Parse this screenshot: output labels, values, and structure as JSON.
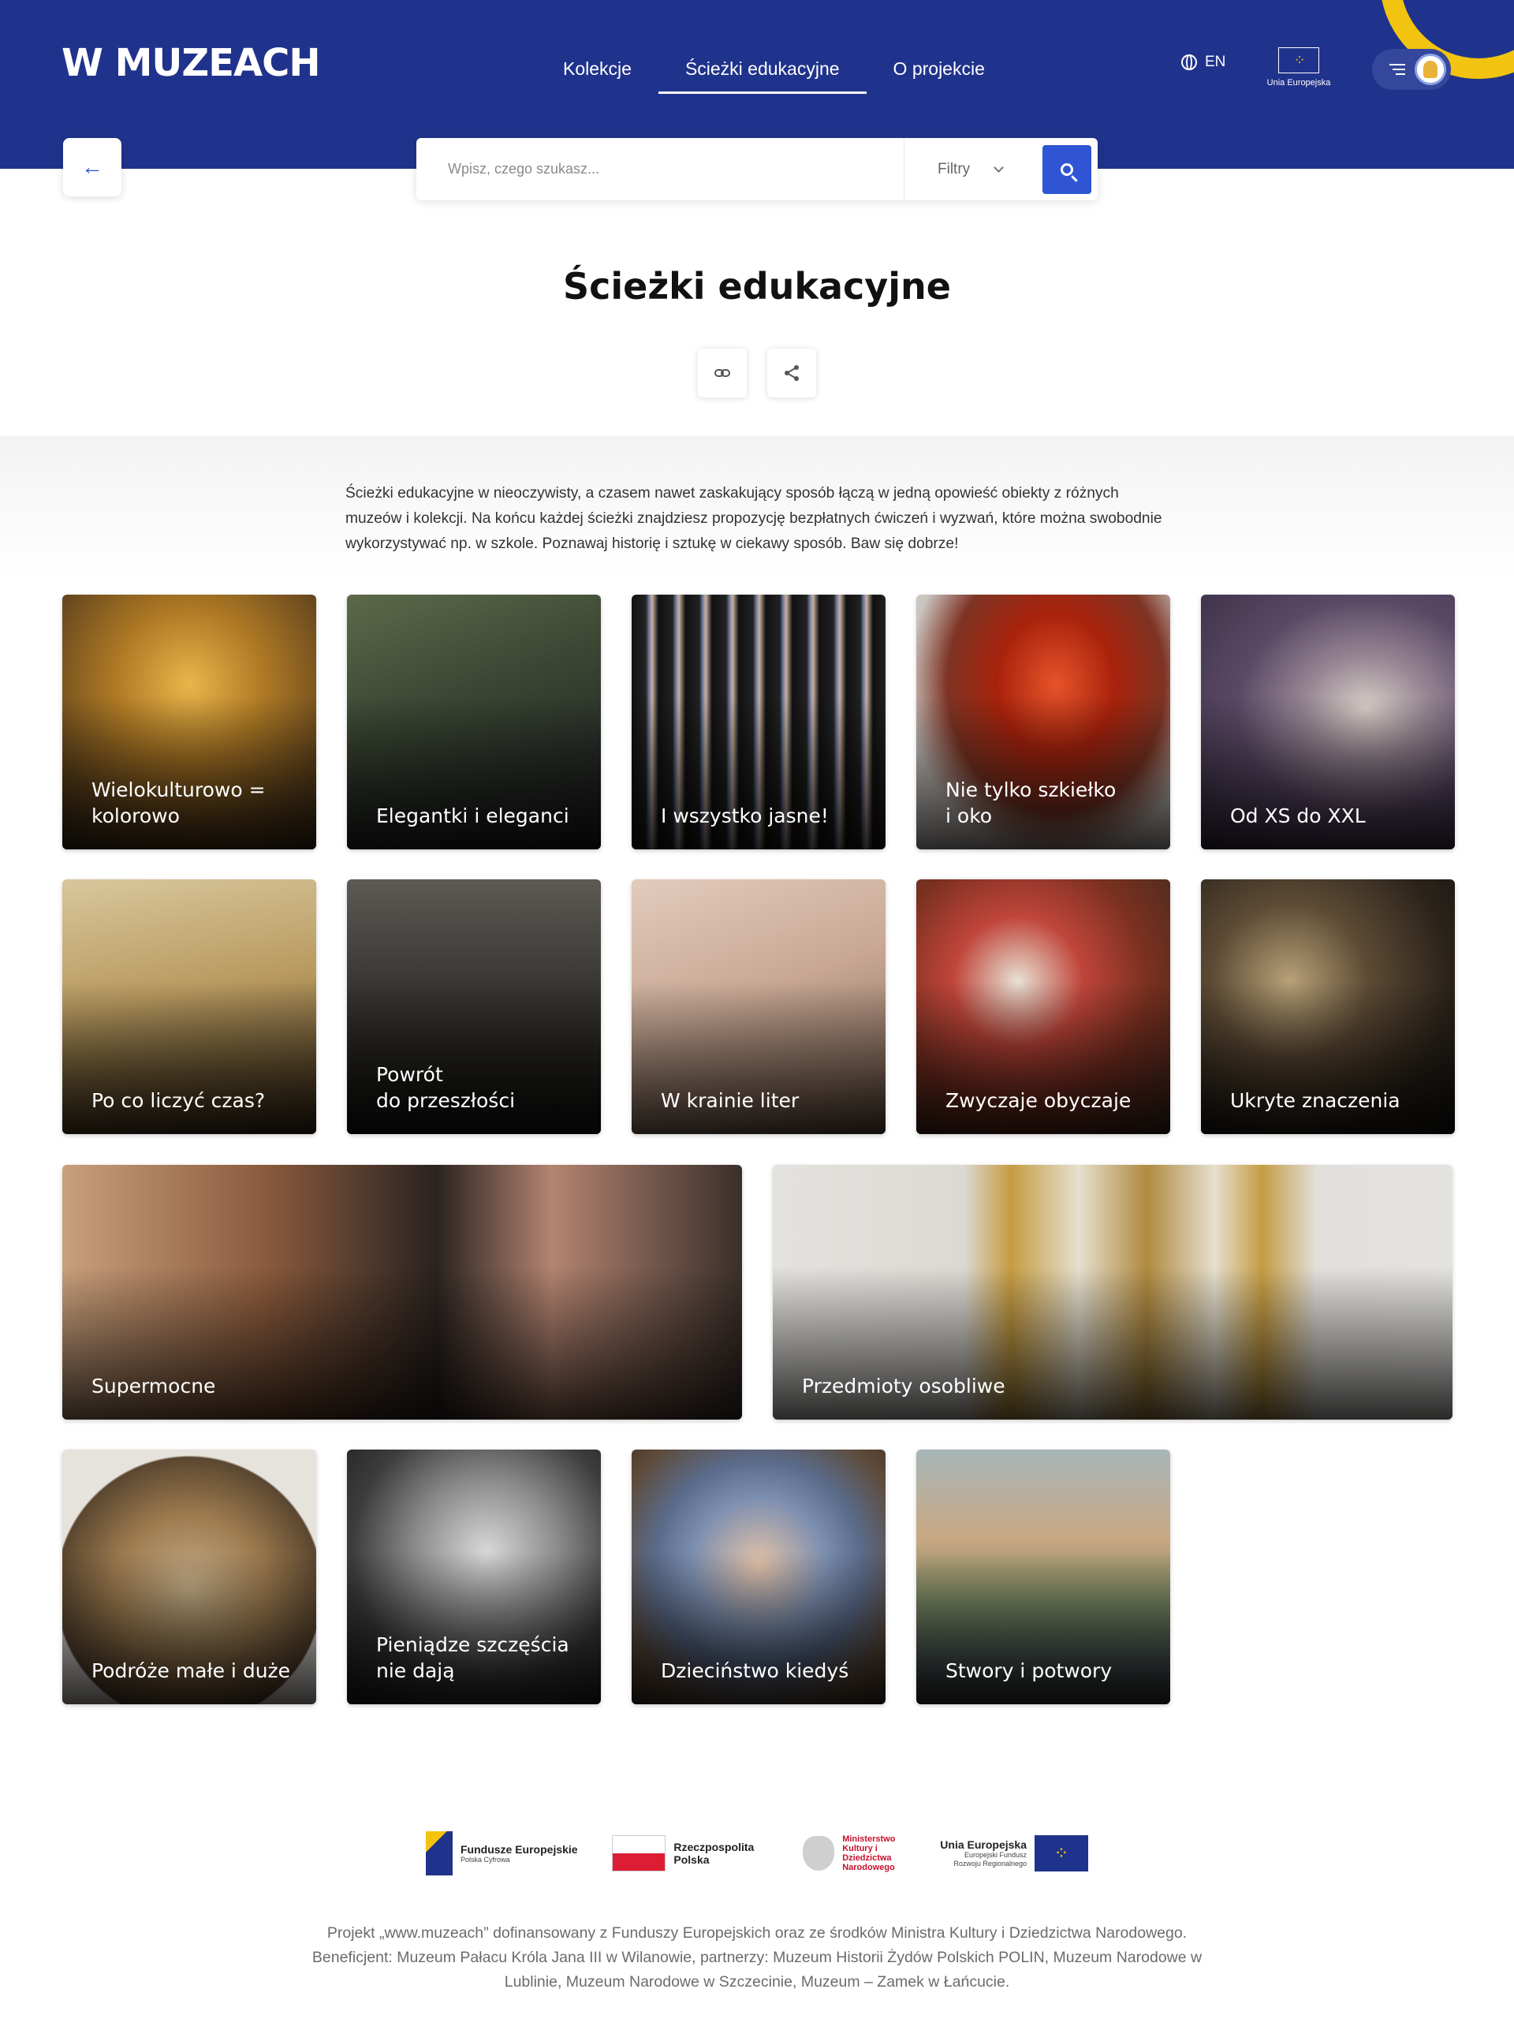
{
  "header": {
    "logo": "W MUZEACH",
    "nav": [
      "Kolekcje",
      "Ścieżki edukacyjne",
      "O projekcie"
    ],
    "active_nav": "Ścieżki edukacyjne",
    "lang": "EN",
    "eu_label": "Unia Europejska"
  },
  "colors": {
    "header_bg": "#20338c",
    "accent": "#2f55d4",
    "sun": "#f2c40f"
  },
  "icons": {
    "back": "arrow-left-icon",
    "search": "search-icon",
    "link": "link-icon",
    "share": "share-icon",
    "menu": "menu-icon",
    "globe": "globe-icon"
  },
  "search": {
    "placeholder": "Wpisz, czego szukasz...",
    "filters_label": "Filtry"
  },
  "page": {
    "title": "Ścieżki edukacyjne",
    "intro": "Ścieżki edukacyjne w nieoczywisty, a czasem nawet zaskakujący sposób łączą w jedną opowieść obiekty z różnych muzeów i kolekcji. Na końcu każdej ścieżki znajdziesz propozycję bezpłatnych ćwiczeń i wyzwań, które można swobodnie wykorzystywać np. w szkole. Poznawaj historię i sztukę w ciekawy sposób. Baw się dobrze!"
  },
  "cards": [
    {
      "label": "Wielokulturowo =\nkolorowo"
    },
    {
      "label": "Elegantki i eleganci"
    },
    {
      "label": "I wszystko jasne!"
    },
    {
      "label": "Nie tylko szkiełko\ni oko"
    },
    {
      "label": "Od XS do XXL"
    },
    {
      "label": "Po co liczyć czas?"
    },
    {
      "label": "Powrót\ndo przeszłości"
    },
    {
      "label": "W krainie liter"
    },
    {
      "label": "Zwyczaje obyczaje"
    },
    {
      "label": "Ukryte znaczenia"
    },
    {
      "label": "Supermocne"
    },
    {
      "label": "Przedmioty osobliwe"
    },
    {
      "label": "Podróże małe i duże"
    },
    {
      "label": "Pieniądze szczęścia\nnie dają"
    },
    {
      "label": "Dzieciństwo kiedyś"
    },
    {
      "label": "Stwory i potwory"
    }
  ],
  "footer": {
    "logos": [
      {
        "name": "Fundusze Europejskie",
        "sub": "Polska Cyfrowa"
      },
      {
        "name": "Rzeczpospolita Polska"
      },
      {
        "name": "Ministerstwo Kultury i Dziedzictwa Narodowego"
      },
      {
        "name": "Unia Europejska",
        "sub": "Europejski Fundusz Rozwoju Regionalnego"
      }
    ],
    "text": "Projekt „www.muzeach” dofinansowany z Funduszy Europejskich oraz ze środków Ministra Kultury i Dziedzictwa Narodowego. Beneficjent: Muzeum Pałacu Króla Jana III w Wilanowie, partnerzy: Muzeum Historii Żydów Polskich POLIN, Muzeum Narodowe w Lublinie, Muzeum Narodowe w Szczecinie, Muzeum – Zamek w Łańcucie."
  }
}
